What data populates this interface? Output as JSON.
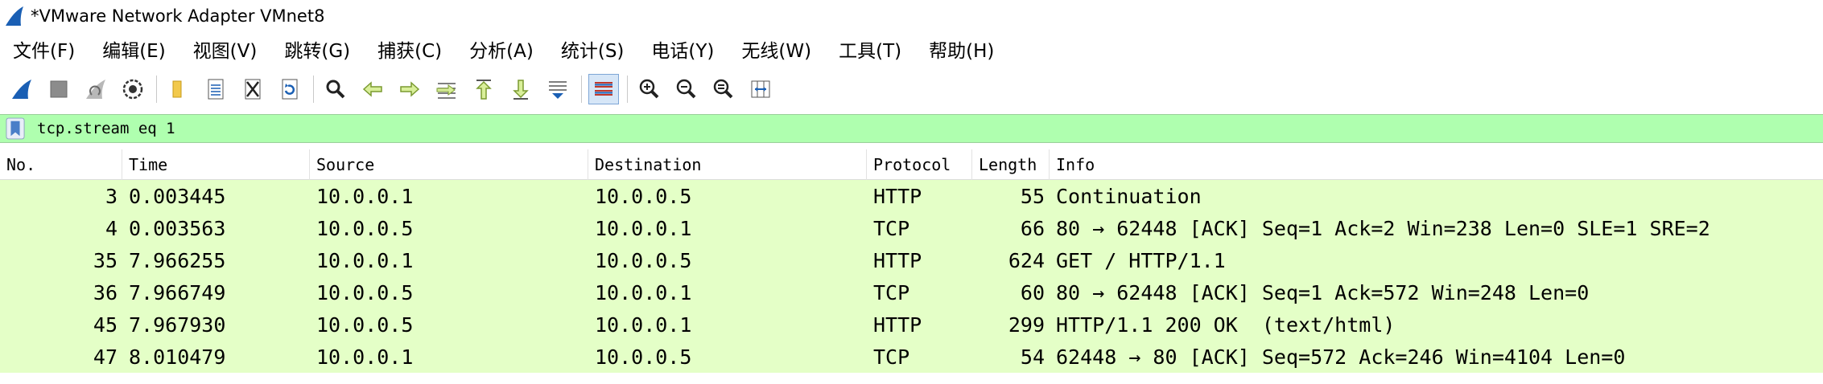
{
  "window": {
    "title": "*VMware Network Adapter VMnet8"
  },
  "menu": [
    "文件(F)",
    "编辑(E)",
    "视图(V)",
    "跳转(G)",
    "捕获(C)",
    "分析(A)",
    "统计(S)",
    "电话(Y)",
    "无线(W)",
    "工具(T)",
    "帮助(H)"
  ],
  "toolbar": {
    "icons": [
      "shark-fin-start-icon",
      "stop-square-icon",
      "restart-fin-icon",
      "gear-options-icon",
      "folder-open-icon",
      "save-file-icon",
      "close-file-icon",
      "reload-icon",
      "find-magnifier-icon",
      "back-arrow-icon",
      "forward-arrow-icon",
      "goto-packet-icon",
      "first-packet-icon",
      "last-packet-icon",
      "autoscroll-icon",
      "colorize-icon",
      "zoom-in-icon",
      "zoom-out-icon",
      "zoom-normal-icon",
      "resize-columns-icon"
    ]
  },
  "filter": {
    "value": "tcp.stream eq 1"
  },
  "colors": {
    "filter_bg": "#afffaf",
    "row_bg": "#e4ffc7",
    "accent": "#1a5fb4"
  },
  "columns": [
    "No.",
    "Time",
    "Source",
    "Destination",
    "Protocol",
    "Length",
    "Info"
  ],
  "packets": [
    {
      "no": "3",
      "time": "0.003445",
      "source": "10.0.0.1",
      "destination": "10.0.0.5",
      "protocol": "HTTP",
      "length": "55",
      "info": "Continuation"
    },
    {
      "no": "4",
      "time": "0.003563",
      "source": "10.0.0.5",
      "destination": "10.0.0.1",
      "protocol": "TCP",
      "length": "66",
      "info": "80 → 62448 [ACK] Seq=1 Ack=2 Win=238 Len=0 SLE=1 SRE=2"
    },
    {
      "no": "35",
      "time": "7.966255",
      "source": "10.0.0.1",
      "destination": "10.0.0.5",
      "protocol": "HTTP",
      "length": "624",
      "info": "GET / HTTP/1.1"
    },
    {
      "no": "36",
      "time": "7.966749",
      "source": "10.0.0.5",
      "destination": "10.0.0.1",
      "protocol": "TCP",
      "length": "60",
      "info": "80 → 62448 [ACK] Seq=1 Ack=572 Win=248 Len=0"
    },
    {
      "no": "45",
      "time": "7.967930",
      "source": "10.0.0.5",
      "destination": "10.0.0.1",
      "protocol": "HTTP",
      "length": "299",
      "info": "HTTP/1.1 200 OK  (text/html)"
    },
    {
      "no": "47",
      "time": "8.010479",
      "source": "10.0.0.1",
      "destination": "10.0.0.5",
      "protocol": "TCP",
      "length": "54",
      "info": "62448 → 80 [ACK] Seq=572 Ack=246 Win=4104 Len=0"
    }
  ]
}
